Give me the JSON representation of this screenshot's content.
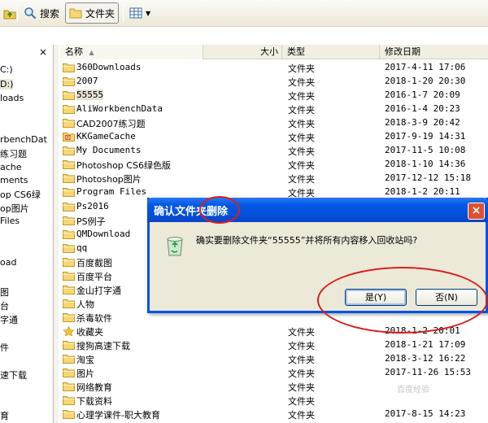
{
  "toolbar": {
    "search_label": "搜索",
    "folders_label": "文件夹"
  },
  "header": {
    "name": "名称",
    "size": "大小",
    "type": "类型",
    "modified": "修改日期"
  },
  "folder_pane": {
    "close": "×",
    "items": [
      "C:)",
      "D:)",
      "loads",
      "",
      "rbenchDat",
      "练习题",
      "ache",
      "ments",
      "op CS6绿",
      "op图片",
      " Files",
      "",
      "",
      "oad",
      "",
      "图",
      "台",
      "字通",
      "",
      "件",
      "",
      "速下载",
      "",
      "",
      "育"
    ]
  },
  "files": [
    {
      "name": "360Downloads",
      "type": "文件夹",
      "date": "2017-4-11 17:06",
      "icon": "folder-icon"
    },
    {
      "name": "2007",
      "type": "文件夹",
      "date": "2018-1-20 20:30",
      "icon": "folder-icon"
    },
    {
      "name": "55555",
      "type": "文件夹",
      "date": "2016-1-7 20:09",
      "icon": "folder-icon"
    },
    {
      "name": "AliWorkbenchData",
      "type": "文件夹",
      "date": "2016-1-4 20:23",
      "icon": "folder-icon"
    },
    {
      "name": "CAD2007练习题",
      "type": "文件夹",
      "date": "2018-3-9 20:42",
      "icon": "folder-icon"
    },
    {
      "name": "KKGameCache",
      "type": "文件夹",
      "date": "2017-9-19 14:31",
      "icon": "kk-folder-icon"
    },
    {
      "name": "My Documents",
      "type": "文件夹",
      "date": "2017-11-5 10:08",
      "icon": "folder-icon"
    },
    {
      "name": "Photoshop CS6绿色版",
      "type": "文件夹",
      "date": "2018-1-10 14:36",
      "icon": "folder-icon"
    },
    {
      "name": "Photoshop图片",
      "type": "文件夹",
      "date": "2017-12-12 15:18",
      "icon": "folder-icon"
    },
    {
      "name": "Program Files",
      "type": "文件夹",
      "date": "2018-1-2 20:11",
      "icon": "folder-icon"
    },
    {
      "name": "Ps2016",
      "type": "",
      "date": "",
      "icon": "folder-icon"
    },
    {
      "name": "PS例子",
      "type": "",
      "date": "",
      "icon": "folder-icon"
    },
    {
      "name": "QMDownload",
      "type": "",
      "date": "",
      "icon": "folder-icon"
    },
    {
      "name": "qq",
      "type": "",
      "date": "",
      "icon": "folder-icon"
    },
    {
      "name": "百度截图",
      "type": "",
      "date": "",
      "icon": "folder-icon"
    },
    {
      "name": "百度平台",
      "type": "",
      "date": "",
      "icon": "folder-icon"
    },
    {
      "name": "金山打字通",
      "type": "",
      "date": "",
      "icon": "folder-icon"
    },
    {
      "name": "人物",
      "type": "",
      "date": "",
      "icon": "folder-icon"
    },
    {
      "name": "杀毒软件",
      "type": "",
      "date": "",
      "icon": "folder-icon"
    },
    {
      "name": "收藏夹",
      "type": "文件夹",
      "date": "2018-1-2 20:01",
      "icon": "favorites-star-icon"
    },
    {
      "name": "搜狗高速下载",
      "type": "文件夹",
      "date": "2018-1-21 17:09",
      "icon": "folder-icon"
    },
    {
      "name": "淘宝",
      "type": "文件夹",
      "date": "2018-3-12 16:22",
      "icon": "folder-icon"
    },
    {
      "name": "图片",
      "type": "文件夹",
      "date": "2017-11-26 15:53",
      "icon": "folder-icon"
    },
    {
      "name": "网络教育",
      "type": "文件夹",
      "date": "",
      "icon": "folder-icon"
    },
    {
      "name": "下载资料",
      "type": "文件夹",
      "date": "",
      "icon": "folder-icon"
    },
    {
      "name": "心理学课件-职大教育",
      "type": "文件夹",
      "date": "2017-8-15 14:23",
      "icon": "folder-icon"
    }
  ],
  "dialog": {
    "title": "确认文件夹删除",
    "message": "确实要删除文件夹“55555”并将所有内容移入回收站吗?",
    "yes": "是(Y)",
    "no": "否(N)",
    "close": "×"
  },
  "watermark": "百度经验"
}
